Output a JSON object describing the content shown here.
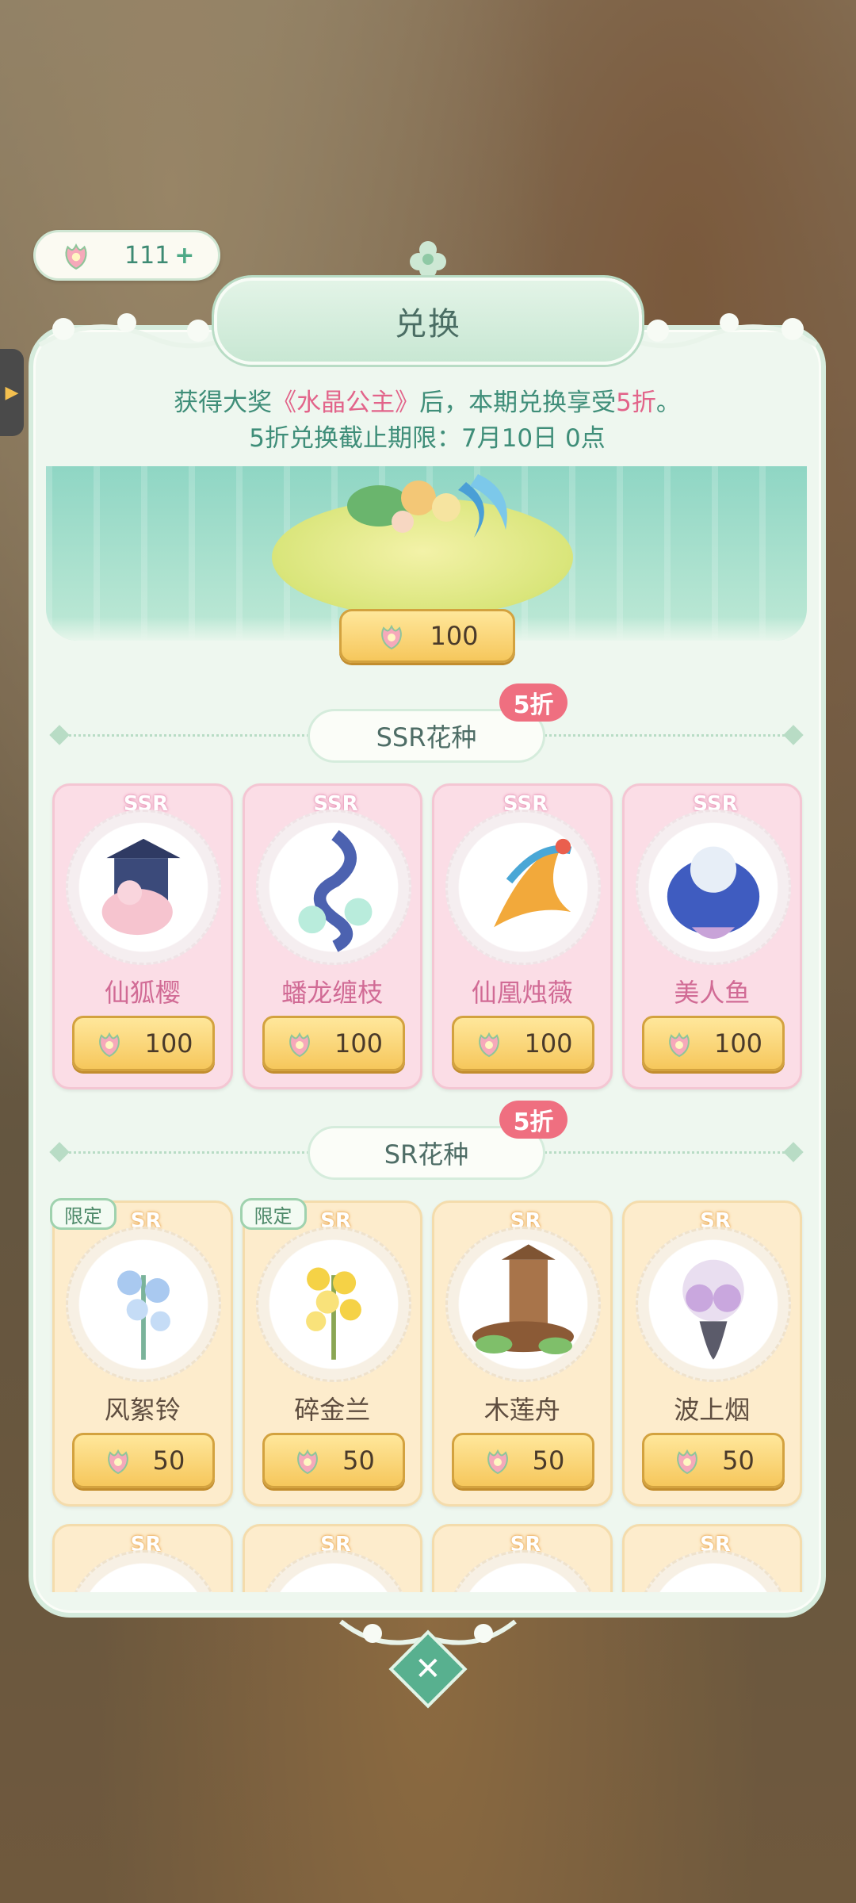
{
  "currency": {
    "amount": "111",
    "plus": "+"
  },
  "dialog": {
    "title": "兑换",
    "notice_prefix": "获得大奖",
    "notice_prize": "《水晶公主》",
    "notice_middle": "后，本期兑换享受",
    "notice_discount": "5折",
    "notice_suffix": "。",
    "deadline": "5折兑换截止期限：7月10日 0点"
  },
  "banner": {
    "price": "100"
  },
  "sections": {
    "ssr": {
      "title": "SSR花种",
      "discount": "5折"
    },
    "sr": {
      "title": "SR花种",
      "discount": "5折"
    }
  },
  "ssr_items": [
    {
      "rarity": "SSR",
      "name": "仙狐樱",
      "price": "100"
    },
    {
      "rarity": "SSR",
      "name": "蟠龙缠枝",
      "price": "100"
    },
    {
      "rarity": "SSR",
      "name": "仙凰烛薇",
      "price": "100"
    },
    {
      "rarity": "SSR",
      "name": "美人鱼",
      "price": "100"
    }
  ],
  "sr_items": [
    {
      "rarity": "SR",
      "name": "风絮铃",
      "price": "50",
      "badge": "限定"
    },
    {
      "rarity": "SR",
      "name": "碎金兰",
      "price": "50",
      "badge": "限定"
    },
    {
      "rarity": "SR",
      "name": "木莲舟",
      "price": "50"
    },
    {
      "rarity": "SR",
      "name": "波上烟",
      "price": "50"
    }
  ],
  "sr_items_row2": [
    {
      "rarity": "SR"
    },
    {
      "rarity": "SR"
    },
    {
      "rarity": "SR"
    },
    {
      "rarity": "SR"
    }
  ],
  "close": {
    "symbol": "✕"
  },
  "colors": {
    "accent_green": "#3f8e79",
    "highlight_pink": "#e2648a",
    "discount_badge": "#ef6f80",
    "price_gold": "#f6c75c"
  }
}
